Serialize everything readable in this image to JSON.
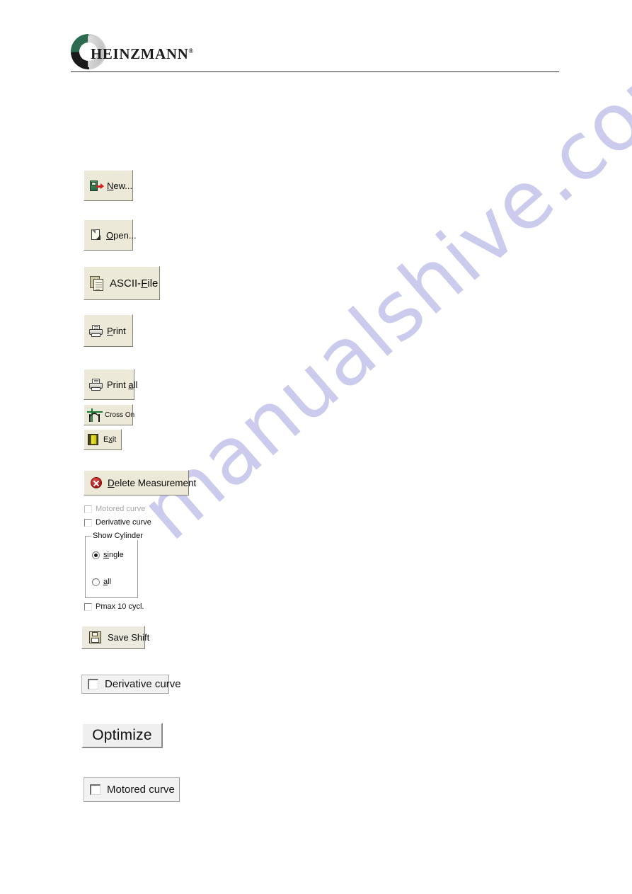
{
  "header": {
    "brand_name": "HEINZMANN",
    "registered_mark": "®",
    "logo_icon": "heinzmann-ring-logo"
  },
  "watermark": {
    "text": "manualshive.com",
    "color": "#c9c9ee"
  },
  "controls": {
    "new_button": {
      "label_pre": "",
      "accel": "N",
      "label_post": "ew...",
      "icon": "new-device-icon"
    },
    "open_button": {
      "accel": "O",
      "label_post": "pen...",
      "icon": "open-document-icon"
    },
    "ascii_button": {
      "label_pre": "ASCII-",
      "accel": "F",
      "label_post": "ile",
      "icon": "ascii-documents-icon"
    },
    "print_button": {
      "accel": "P",
      "label_post": "rint",
      "icon": "printer-icon"
    },
    "print_all_button": {
      "label_pre": "Print ",
      "accel": "a",
      "label_post": "ll",
      "icon": "printer-icon"
    },
    "cross_on_button": {
      "label": "Cross On",
      "icon": "cross-curve-icon"
    },
    "exit_button": {
      "label_pre": "E",
      "accel": "x",
      "label_post": "it",
      "icon": "exit-door-icon"
    },
    "delete_measurement_button": {
      "accel": "D",
      "label_post": "elete Measurement",
      "icon": "delete-circle-x-icon"
    },
    "save_shift_button": {
      "label": "Save Shift",
      "icon": "floppy-disk-icon"
    },
    "optimize_button": {
      "label": "Optimize"
    }
  },
  "options_panel": {
    "motored_curve": {
      "label": "Motored curve",
      "checked": false,
      "enabled": false
    },
    "derivative_curve": {
      "label": "Derivative curve",
      "checked": false,
      "enabled": true
    },
    "show_cylinder_group": {
      "title": "Show Cylinder",
      "options": [
        {
          "accel": "si",
          "label_post": "ngle",
          "full": "single",
          "selected": true
        },
        {
          "accel": "a",
          "label_post": "ll",
          "full": "all",
          "selected": false
        }
      ]
    },
    "pmax_checkbox": {
      "label": "Pmax 10 cycl.",
      "checked": false
    }
  },
  "standalone": {
    "derivative_curve_checkbox": {
      "label": "Derivative curve",
      "checked": false
    },
    "motored_curve_checkbox": {
      "label": "Motored curve",
      "checked": false
    }
  }
}
